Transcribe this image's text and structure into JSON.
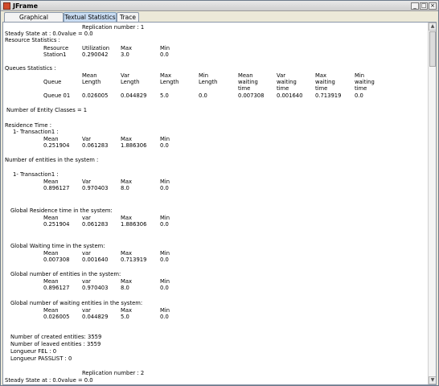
{
  "window": {
    "title": "JFrame",
    "minimize": "_",
    "maximize": "□",
    "close": "×"
  },
  "tabs": [
    {
      "label": "Graphical Statistics",
      "active": false
    },
    {
      "label": "Textual Statistics",
      "active": true
    },
    {
      "label": "Trace",
      "active": false
    }
  ],
  "report": {
    "replication1": "Replication number : 1",
    "steady_state1": "Steady State at : 0.0value = 0.0",
    "resource_stats": "Resource Statistics :",
    "resource_headers": [
      "Resource",
      "Utilization",
      "Max",
      "Min"
    ],
    "resource_row": [
      "Station1",
      "0.290042",
      "3.0",
      "0.0"
    ],
    "queues_stats": "Queues Statistics :",
    "queue_h1": [
      "",
      "Mean",
      "Var",
      "Max",
      "Min",
      "Mean",
      "Var",
      "Max",
      "Min"
    ],
    "queue_h2": [
      "Queue",
      "Length",
      "Length",
      "Length",
      "Length",
      "waiting",
      "waiting",
      "waiting",
      "waiting"
    ],
    "queue_h3": [
      "",
      "",
      "",
      "",
      "",
      "time",
      "time",
      "time",
      "time"
    ],
    "queue_row": [
      "Queue 01",
      "0.026005",
      "0.044829",
      "5.0",
      "0.0",
      "0.007308",
      "0.001640",
      "0.713919",
      "0.0"
    ],
    "entity_classes": "Number of Entity Classes  = 1",
    "residence_time": "Residence Time :",
    "transaction_colon": "1- Transaction1 :",
    "stat_headers": [
      "Mean",
      "Var",
      "Max",
      "Min"
    ],
    "residence_row": [
      "0.251904",
      "0.061283",
      "1.886306",
      "0.0"
    ],
    "entities_in_system": "Number of entities in the system :",
    "transaction_label": "1- Transaction1 :",
    "entities_row": [
      "0.896127",
      "0.970403",
      "8.0",
      "0.0"
    ],
    "global_residence": "Global Residence time in the system:",
    "stat_headers_lc": [
      "Mean",
      "var",
      "Max",
      "Min"
    ],
    "global_residence_row": [
      "0.251904",
      "0.061283",
      "1.886306",
      "0.0"
    ],
    "global_waiting": "Global Waiting time in the system:",
    "global_waiting_row": [
      "0.007308",
      "0.001640",
      "0.713919",
      "0.0"
    ],
    "global_entities": "Global number of entities in the system:",
    "global_entities_row": [
      "0.896127",
      "0.970403",
      "8.0",
      "0.0"
    ],
    "global_waiting_entities": "Global number of waiting entities in the system:",
    "global_waiting_entities_row": [
      "0.026005",
      "0.044829",
      "5.0",
      "0.0"
    ],
    "created": "Number of created entities: 3559",
    "leaved": "Number of leaved entities : 3559",
    "longueur_fel": "Longueur FEL :     0",
    "longueur_passlist": "Longueur PASSLIST : 0",
    "replication2": "Replication number : 2",
    "steady_state2": "Steady State at : 0.0value = 0.0"
  },
  "scrollbar": {
    "up": "▲",
    "down": "▼"
  }
}
